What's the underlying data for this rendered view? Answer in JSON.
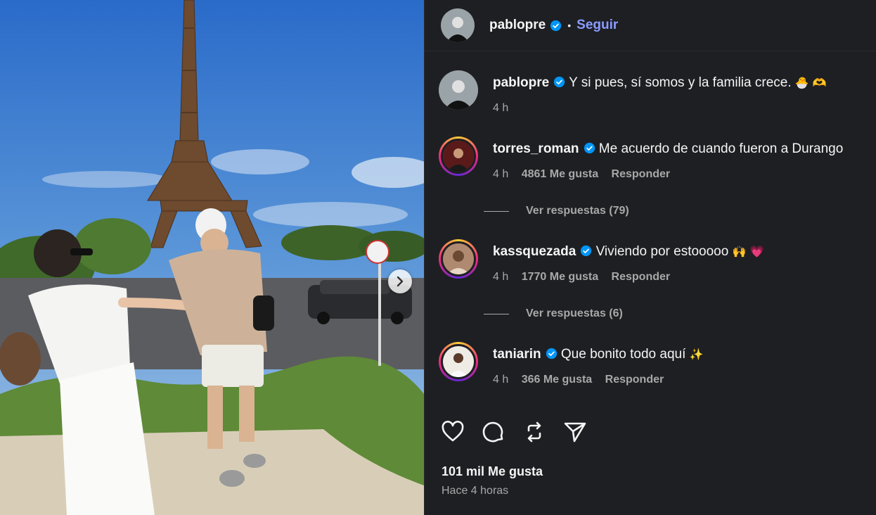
{
  "post": {
    "author": "pablopre",
    "follow_label": "Seguir",
    "dot": "•"
  },
  "caption": {
    "user": "pablopre",
    "text": "Y si pues, sí somos y la familia crece.",
    "emoji": "🐣 🫶",
    "time": "4 h"
  },
  "comments": [
    {
      "user": "torres_roman",
      "text": "Me acuerdo de cuando fueron a Durango",
      "emoji": "",
      "time": "4 h",
      "likes": "4861 Me gusta",
      "reply": "Responder",
      "view_replies": "Ver respuestas (79)"
    },
    {
      "user": "kassquezada",
      "text": "Viviendo por estooooo",
      "emoji": "🙌 💗",
      "time": "4 h",
      "likes": "1770 Me gusta",
      "reply": "Responder",
      "view_replies": "Ver respuestas (6)"
    },
    {
      "user": "taniarin",
      "text": "Que bonito todo aquí",
      "emoji": "✨",
      "time": "4 h",
      "likes": "366 Me gusta",
      "reply": "Responder"
    }
  ],
  "footer": {
    "likes": "101 mil Me gusta",
    "time": "Hace 4 horas"
  },
  "icons": [
    "verified-badge-icon",
    "heart-icon",
    "comment-icon",
    "repost-icon",
    "share-icon",
    "chevron-right-icon"
  ],
  "colors": {
    "panel_bg": "#1e1f23",
    "follow": "#8a9cff",
    "verified": "#0095f6",
    "muted": "#a8a8a8"
  }
}
